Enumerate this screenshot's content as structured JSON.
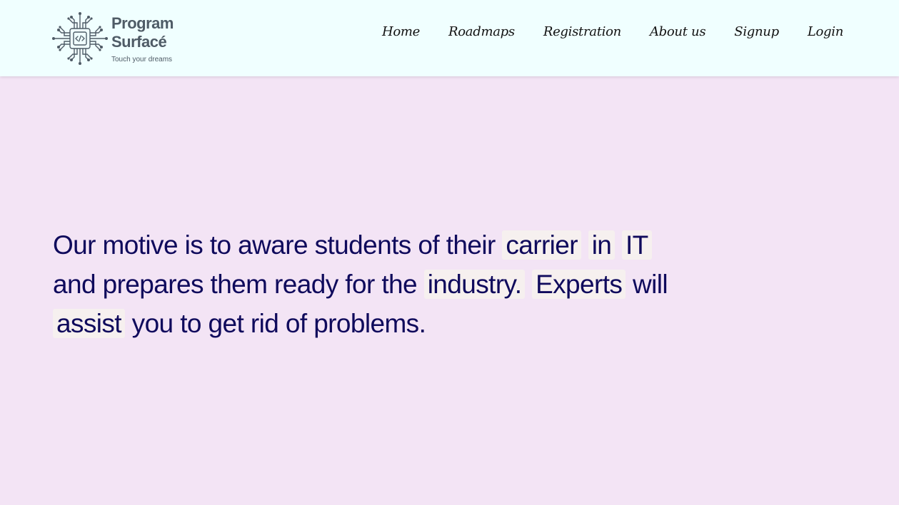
{
  "header": {
    "brand": "Program Surfacé",
    "tagline": "Touch your dreams",
    "logo_icon": "circuit-chip-icon",
    "nav": [
      {
        "label": "Home"
      },
      {
        "label": "Roadmaps"
      },
      {
        "label": "Registration"
      },
      {
        "label": "About us"
      },
      {
        "label": "Signup"
      },
      {
        "label": "Login"
      }
    ]
  },
  "hero": {
    "seg1": "Our motive is to aware students of their",
    "hl1": "carrier",
    "hl2": "in",
    "hl3": "IT",
    "seg2": "and prepares them ready for the",
    "hl4": "industry.",
    "hl5": "Experts",
    "seg3": "will",
    "hl6": "assist",
    "seg4": "you to get rid of problems."
  },
  "colors": {
    "header_bg": "#f0ffff",
    "page_bg": "#f3e4f5",
    "hero_text": "#0f0a5c",
    "highlight_bg": "#f6f0ef",
    "brand_text": "#4f5b66"
  }
}
